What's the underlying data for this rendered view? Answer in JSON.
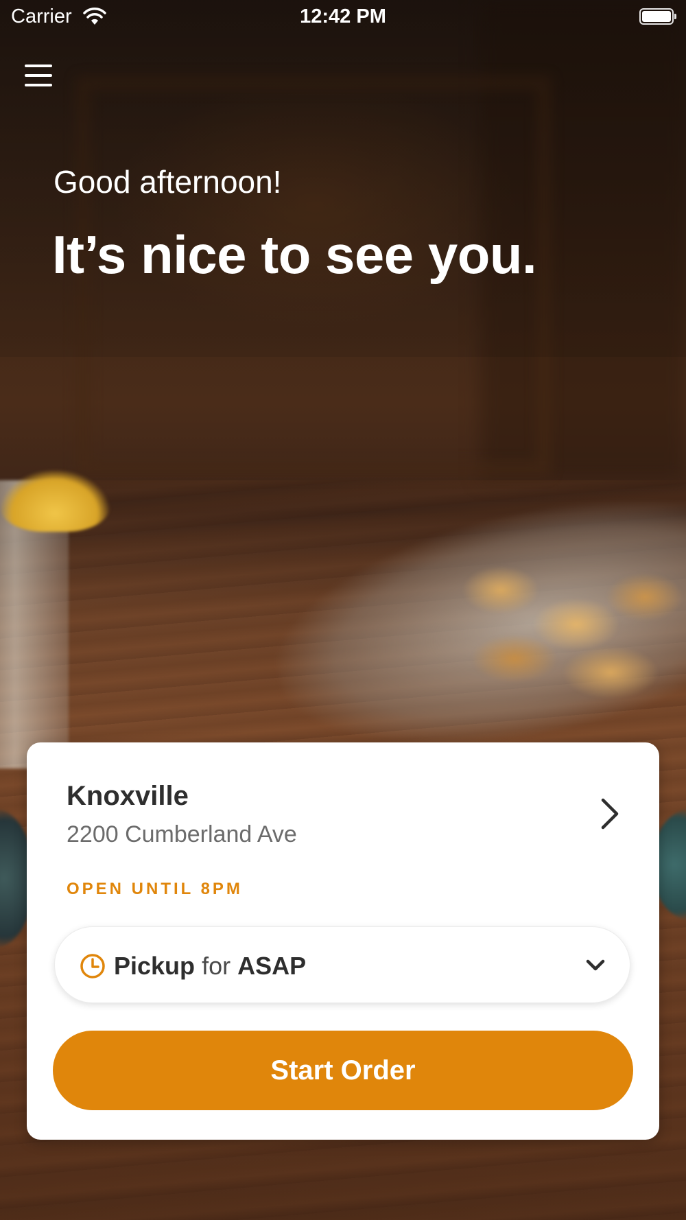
{
  "status_bar": {
    "carrier": "Carrier",
    "time": "12:42 PM"
  },
  "hero": {
    "greeting": "Good afternoon!",
    "headline": "It’s nice to see you."
  },
  "location": {
    "name": "Knoxville",
    "address": "2200 Cumberland Ave",
    "hours": "OPEN UNTIL 8PM"
  },
  "order_time": {
    "mode": "Pickup",
    "connector": "for",
    "when": "ASAP"
  },
  "actions": {
    "start_order_label": "Start Order"
  },
  "colors": {
    "accent": "#e0860b",
    "card": "#ffffff",
    "text_primary": "#2e2e2e",
    "text_secondary": "#6b6b6b"
  },
  "icons": {
    "menu": "hamburger-menu-icon",
    "location_chevron": "chevron-right-icon",
    "clock": "clock-icon",
    "dropdown": "chevron-down-icon",
    "wifi": "wifi-icon",
    "battery": "battery-icon"
  }
}
